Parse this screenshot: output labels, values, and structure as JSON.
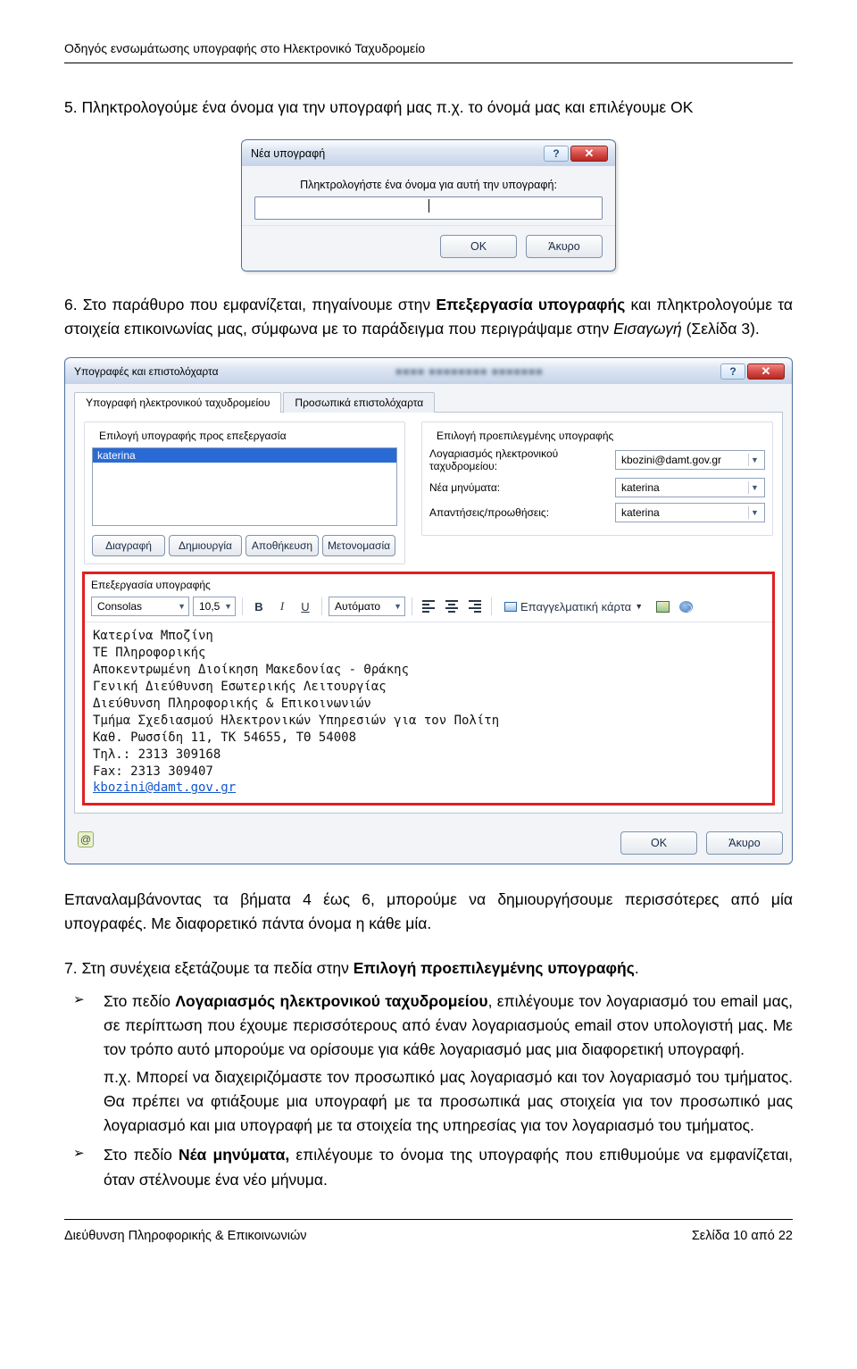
{
  "header": "Οδηγός ενσωμάτωσης υπογραφής στο Ηλεκτρονικό Ταχυδρομείο",
  "step5": "5. Πληκτρολογούμε ένα όνομα για την υπογραφή μας π.χ. το όνομά μας και επιλέγουμε ΟΚ",
  "dlg1": {
    "title": "Νέα υπογραφή",
    "label": "Πληκτρολογήστε ένα όνομα για αυτή την υπογραφή:",
    "ok": "OK",
    "cancel": "Άκυρο"
  },
  "step6_pre": "6. Στο παράθυρο που εμφανίζεται, πηγαίνουμε στην ",
  "step6_bold": "Επεξεργασία υπογραφής",
  "step6_mid": " και πληκτρολογούμε τα στοιχεία επικοινωνίας μας, σύμφωνα με το παράδειγμα που περιγράψαμε στην ",
  "step6_italic": "Εισαγωγή",
  "step6_after": " (Σελίδα 3).",
  "dlg2": {
    "title": "Υπογραφές και επιστολόχαρτα",
    "tab1": "Υπογραφή ηλεκτρονικού ταχυδρομείου",
    "tab2": "Προσωπικά επιστολόχαρτα",
    "leftGroup": "Επιλογή υπογραφής προς επεξεργασία",
    "listItem": "katerina",
    "btnDelete": "Διαγραφή",
    "btnNew": "Δημιουργία",
    "btnSave": "Αποθήκευση",
    "btnRename": "Μετονομασία",
    "rightGroup": "Επιλογή προεπιλεγμένης υπογραφής",
    "acctLabel": "Λογαριασμός ηλεκτρονικού ταχυδρομείου:",
    "acctVal": "kbozini@damt.gov.gr",
    "newLabel": "Νέα μηνύματα:",
    "newVal": "katerina",
    "replLabel": "Απαντήσεις/προωθήσεις:",
    "replVal": "katerina",
    "editTitle": "Επεξεργασία υπογραφής",
    "font": "Consolas",
    "size": "10,5",
    "autoBtn": "Αυτόματο",
    "bizCard": "Επαγγελματική κάρτα",
    "sig": {
      "l1": "Κατερίνα Μποζίνη",
      "l2": "ΤΕ Πληροφορικής",
      "l3": "Αποκεντρωμένη Διοίκηση Μακεδονίας - Θράκης",
      "l4": "Γενική Διεύθυνση Εσωτερικής Λειτουργίας",
      "l5": "Διεύθυνση Πληροφορικής & Επικοινωνιών",
      "l6": "Τμήμα Σχεδιασμού Ηλεκτρονικών Υπηρεσιών για τον Πολίτη",
      "l7": "Καθ. Ρωσσίδη 11, ΤΚ 54655, ΤΘ 54008",
      "l8": "Τηλ.: 2313 309168",
      "l9": "Fax: 2313 309407",
      "l10": "kbozini@damt.gov.gr"
    },
    "ok": "OK",
    "cancel": "Άκυρο"
  },
  "repeat_p": "Επαναλαμβάνοντας τα βήματα 4 έως 6, μπορούμε να δημιουργήσουμε περισσότερες από μία υπογραφές. Με διαφορετικό πάντα όνομα η κάθε μία.",
  "step7_pre": "7. Στη συνέχεια εξετάζουμε τα πεδία στην ",
  "step7_bold": "Επιλογή προεπιλεγμένης υπογραφής",
  "step7_dot": ".",
  "b1_a": "Στο πεδίο ",
  "b1_bold": "Λογαριασμός ηλεκτρονικού ταχυδρομείου",
  "b1_b": ", επιλέγουμε τον λογαριασμό του email μας, σε περίπτωση που έχουμε περισσότερους από έναν λογαριασμούς email στον υπολογιστή μας. Με τον τρόπο αυτό μπορούμε να ορίσουμε για κάθε λογαριασμό μας μια διαφορετική υπογραφή.",
  "b1_c": "π.χ. Μπορεί να διαχειριζόμαστε τον προσωπικό μας λογαριασμό και τον λογαριασμό του τμήματος. Θα πρέπει να φτιάξουμε μια υπογραφή με τα προσωπικά μας στοιχεία για τον προσωπικό μας λογαριασμό και μια υπογραφή με τα στοιχεία της υπηρεσίας για τον λογαριασμό του τμήματος.",
  "b2_a": "Στο πεδίο ",
  "b2_bold": "Νέα μηνύματα,",
  "b2_b": " επιλέγουμε το όνομα της υπογραφής που επιθυμούμε να εμφανίζεται, όταν στέλνουμε ένα νέο μήνυμα.",
  "footerL": "Διεύθυνση Πληροφορικής & Επικοινωνιών",
  "footerR": "Σελίδα 10 από 22"
}
